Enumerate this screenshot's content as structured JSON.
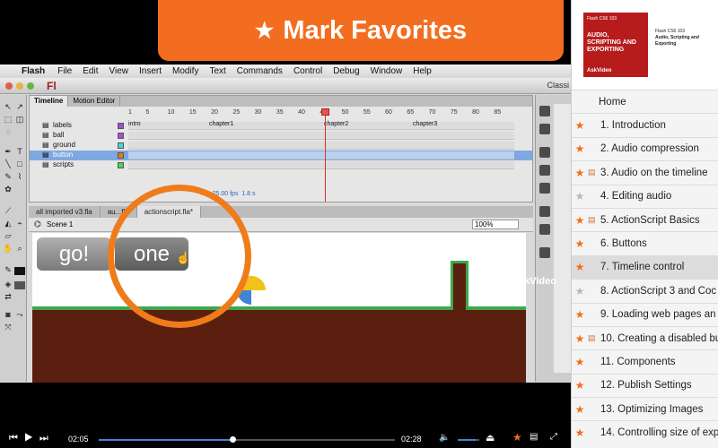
{
  "banner": {
    "star": "★",
    "text": "Mark Favorites"
  },
  "menubar": {
    "apple": "",
    "app": "Flash",
    "items": [
      "File",
      "Edit",
      "View",
      "Insert",
      "Modify",
      "Text",
      "Commands",
      "Control",
      "Debug",
      "Window",
      "Help"
    ]
  },
  "flash": {
    "logo": "Fl",
    "workspace": "Classi",
    "timeline_tabs": [
      "Timeline",
      "Motion Editor"
    ],
    "ruler": [
      "1",
      "5",
      "10",
      "15",
      "20",
      "25",
      "30",
      "35",
      "40",
      "45",
      "50",
      "55",
      "60",
      "65",
      "70",
      "75",
      "80",
      "85"
    ],
    "layers": [
      {
        "name": "labels",
        "color": "#a44bd6"
      },
      {
        "name": "ball",
        "color": "#b04bd6"
      },
      {
        "name": "ground",
        "color": "#4bd6d6"
      },
      {
        "name": "button",
        "color": "#e07a20"
      },
      {
        "name": "scripts",
        "color": "#4bd64b"
      }
    ],
    "frame_labels": [
      "intro",
      "chapter1",
      "chapter2",
      "chapter3"
    ],
    "timeline_status": {
      "frame": "45",
      "fps": "25.00 fps",
      "time": "1.8 s"
    },
    "doc_tabs": [
      "all imported v3.fla",
      "au...fla",
      "actionscript.fla*"
    ],
    "scene": "Scene 1",
    "zoom": "100%",
    "stage_buttons": {
      "go": "go!",
      "one": "one"
    }
  },
  "watermark": "AskVideo",
  "player": {
    "current_time": "02:05",
    "total_time": "02:28",
    "progress": 0.45,
    "volume": 0.85,
    "play_controls": "⏮ ▶ ⏭"
  },
  "course": {
    "cover_series": "Flash CS6 103",
    "cover_title": "AUDIO, SCRIPTING AND EXPORTING",
    "cover_brand": "AskVideo",
    "series": "Flash CS6 103",
    "title": "Audio, Scripting and Exporting"
  },
  "lessons": [
    {
      "label": "Home",
      "star": "",
      "doc": false,
      "home": true
    },
    {
      "label": "1. Introduction",
      "star": "orange",
      "doc": false
    },
    {
      "label": "2. Audio compression",
      "star": "orange",
      "doc": false
    },
    {
      "label": "3. Audio on the timeline",
      "star": "orange",
      "doc": true
    },
    {
      "label": "4. Editing audio",
      "star": "grey",
      "doc": false
    },
    {
      "label": "5. ActionScript Basics",
      "star": "orange",
      "doc": true
    },
    {
      "label": "6. Buttons",
      "star": "orange",
      "doc": false
    },
    {
      "label": "7. Timeline control",
      "star": "orange",
      "doc": false,
      "current": true
    },
    {
      "label": "8. ActionScript 3 and Coc",
      "star": "grey",
      "doc": false
    },
    {
      "label": "9. Loading web pages an",
      "star": "orange",
      "doc": false
    },
    {
      "label": "10. Creating a disabled bu",
      "star": "orange",
      "doc": true
    },
    {
      "label": "11. Components",
      "star": "orange",
      "doc": false
    },
    {
      "label": "12. Publish Settings",
      "star": "orange",
      "doc": false
    },
    {
      "label": "13. Optimizing Images",
      "star": "orange",
      "doc": false
    },
    {
      "label": "14. Controlling size of exp",
      "star": "orange",
      "doc": false
    }
  ]
}
